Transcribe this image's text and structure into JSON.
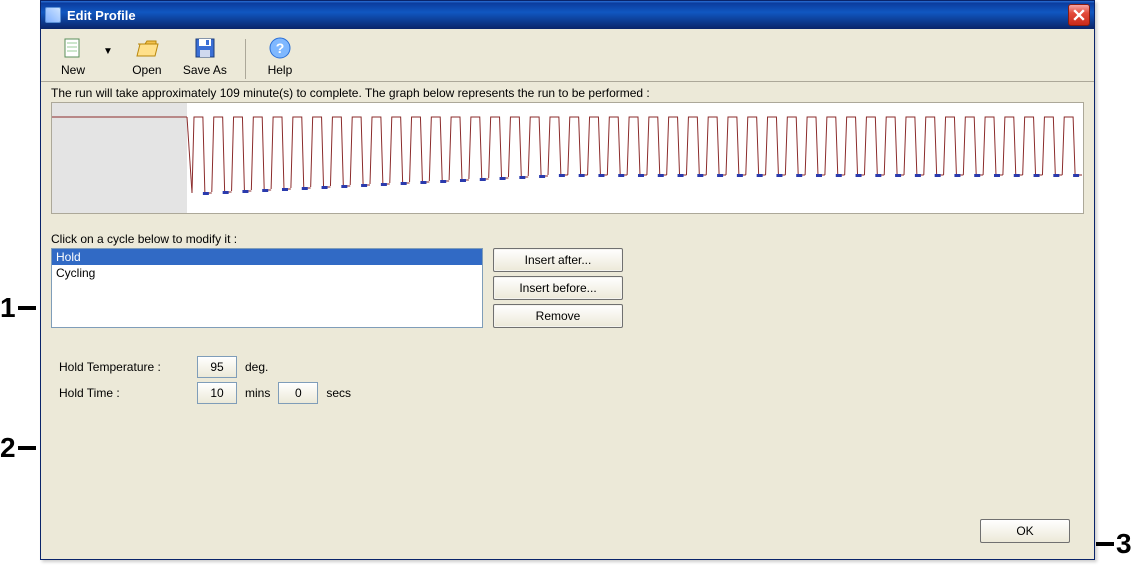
{
  "window": {
    "title": "Edit Profile"
  },
  "toolbar": {
    "new": "New",
    "open": "Open",
    "saveas": "Save As",
    "help": "Help"
  },
  "run_info": "The run will take approximately 109 minute(s) to complete. The graph below represents the run to be performed :",
  "click_label": "Click on a cycle below to modify it :",
  "cycle_list": {
    "items": [
      "Hold",
      "Cycling"
    ],
    "selected_index": 0
  },
  "buttons": {
    "insert_after": "Insert after...",
    "insert_before": "Insert before...",
    "remove": "Remove",
    "ok": "OK"
  },
  "hold": {
    "temp_label": "Hold Temperature :",
    "temp_value": "95",
    "temp_unit": "deg.",
    "time_label": "Hold Time :",
    "time_mins": "10",
    "mins_unit": "mins",
    "time_secs": "0",
    "secs_unit": "secs"
  },
  "annotations": {
    "n1": "1",
    "n2": "2",
    "n3": "3"
  },
  "chart_data": {
    "type": "line",
    "title": "",
    "xlabel": "",
    "ylabel": "",
    "segments": [
      {
        "name": "Hold",
        "temperature_deg": 95,
        "duration_min": 10,
        "duration_sec": 0
      },
      {
        "name": "Cycling",
        "cycles": 45,
        "pattern": "denature-anneal-extend spikes"
      }
    ],
    "total_minutes_estimate": 109
  }
}
